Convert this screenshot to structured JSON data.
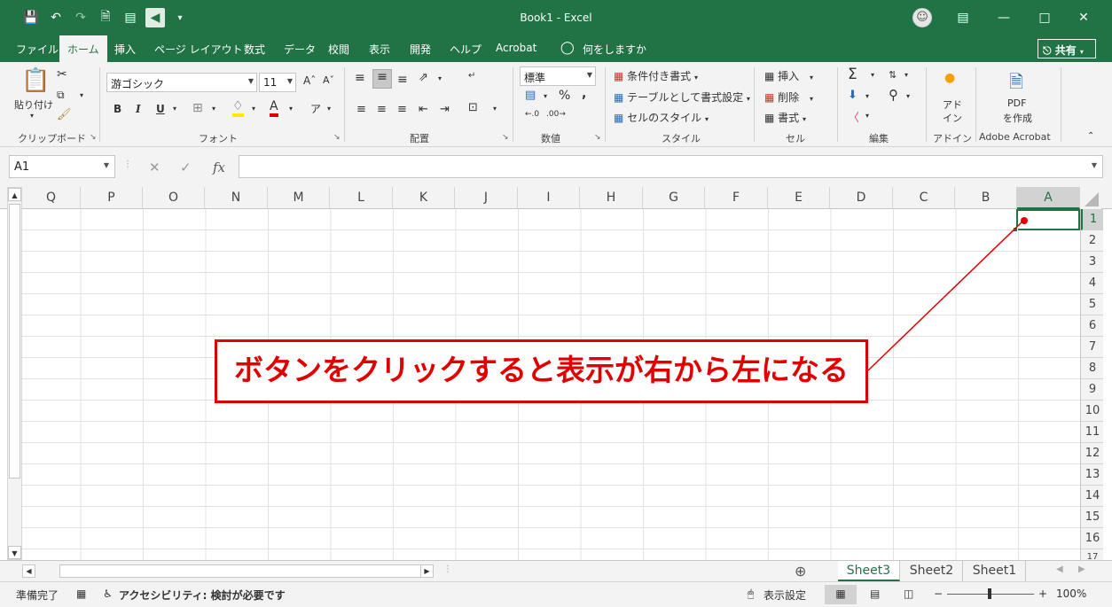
{
  "window": {
    "title": "Book1  -  Excel",
    "account_icon": "account-avatar-icon",
    "buttons": [
      "ribbon-display-options-icon",
      "minimize-icon",
      "restore-icon",
      "close-icon"
    ]
  },
  "qat": {
    "icons": [
      "save-icon",
      "undo-icon",
      "redo-icon",
      "new-file-icon",
      "form-icon",
      "right-to-left-icon",
      "customize-qat-icon"
    ]
  },
  "menu": {
    "tabs": [
      "ファイル",
      "ホーム",
      "挿入",
      "ページ レイアウト",
      "数式",
      "データ",
      "校閲",
      "表示",
      "開発",
      "ヘルプ",
      "Acrobat"
    ],
    "active": "ホーム",
    "tell_me": "何をしますか",
    "share": "共有"
  },
  "ribbon": {
    "clipboard": {
      "paste": "貼り付け",
      "group": "クリップボード"
    },
    "font": {
      "name": "游ゴシック",
      "size": "11",
      "group": "フォント",
      "bold": "B",
      "italic": "I",
      "underline": "U",
      "font_color": "A",
      "phonetic": "ア"
    },
    "alignment": {
      "group": "配置"
    },
    "number": {
      "format": "標準",
      "percent": "%",
      "comma": ",",
      "group": "数値"
    },
    "styles": {
      "conditional": "条件付き書式",
      "table": "テーブルとして書式設定",
      "cell_styles": "セルのスタイル",
      "group": "スタイル"
    },
    "cells": {
      "insert": "挿入",
      "delete": "削除",
      "format": "書式",
      "group": "セル"
    },
    "editing": {
      "group": "編集"
    },
    "addins": {
      "label_line1": "アド",
      "label_line2": "イン",
      "group": "アドイン"
    },
    "acrobat": {
      "label_line1": "PDF",
      "label_line2": "を作成",
      "group": "Adobe Acrobat"
    }
  },
  "formula_bar": {
    "name_box": "A1",
    "fx": "fx",
    "value": ""
  },
  "grid": {
    "columns": [
      "Q",
      "P",
      "O",
      "N",
      "M",
      "L",
      "K",
      "J",
      "I",
      "H",
      "G",
      "F",
      "E",
      "D",
      "C",
      "B",
      "A"
    ],
    "rows": [
      "1",
      "2",
      "3",
      "4",
      "5",
      "6",
      "7",
      "8",
      "9",
      "10",
      "11",
      "12",
      "13",
      "14",
      "15",
      "16",
      "17"
    ],
    "selected_cell": "A1"
  },
  "annotation": {
    "text": "ボタンをクリックすると表示が右から左になる",
    "color": "#e00000"
  },
  "sheets": {
    "tabs": [
      "Sheet3",
      "Sheet2",
      "Sheet1"
    ],
    "active": "Sheet3"
  },
  "status": {
    "ready": "準備完了",
    "accessibility": "アクセシビリティ: 検討が必要です",
    "display_settings": "表示設定",
    "zoom": "100%"
  },
  "theme": {
    "accent": "#217346",
    "ribbon_bg": "#f3f3f3"
  }
}
